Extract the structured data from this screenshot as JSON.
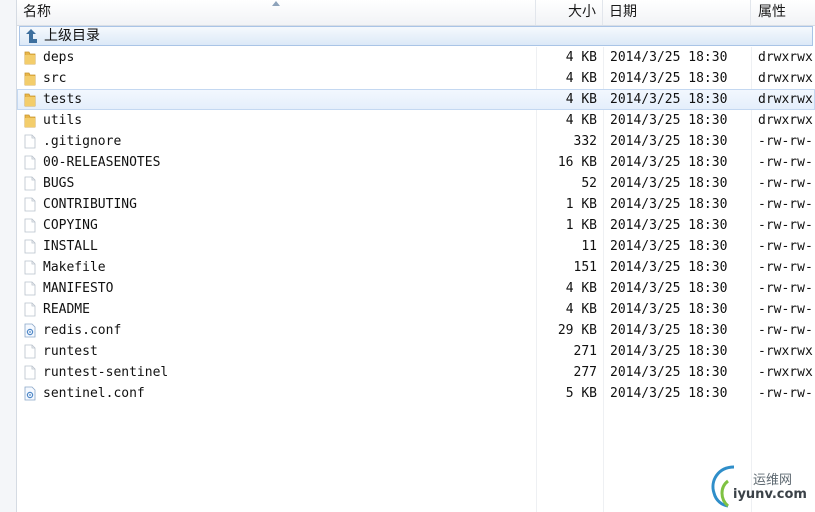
{
  "columns": {
    "name": "名称",
    "size": "大小",
    "date": "日期",
    "attributes": "属性"
  },
  "up_row": {
    "label": "上级目录"
  },
  "files": [
    {
      "name": "deps",
      "size": "4 KB",
      "date": "2014/3/25 18:30",
      "attr": "drwxrwxr",
      "type": "folder"
    },
    {
      "name": "src",
      "size": "4 KB",
      "date": "2014/3/25 18:30",
      "attr": "drwxrwxr",
      "type": "folder"
    },
    {
      "name": "tests",
      "size": "4 KB",
      "date": "2014/3/25 18:30",
      "attr": "drwxrwxr",
      "type": "folder",
      "selected": true
    },
    {
      "name": "utils",
      "size": "4 KB",
      "date": "2014/3/25 18:30",
      "attr": "drwxrwxr",
      "type": "folder"
    },
    {
      "name": ".gitignore",
      "size": "332",
      "date": "2014/3/25 18:30",
      "attr": "-rw-rw-r",
      "type": "file"
    },
    {
      "name": "00-RELEASENOTES",
      "size": "16 KB",
      "date": "2014/3/25 18:30",
      "attr": "-rw-rw-r",
      "type": "file"
    },
    {
      "name": "BUGS",
      "size": "52",
      "date": "2014/3/25 18:30",
      "attr": "-rw-rw-r",
      "type": "file"
    },
    {
      "name": "CONTRIBUTING",
      "size": "1 KB",
      "date": "2014/3/25 18:30",
      "attr": "-rw-rw-r",
      "type": "file"
    },
    {
      "name": "COPYING",
      "size": "1 KB",
      "date": "2014/3/25 18:30",
      "attr": "-rw-rw-r",
      "type": "file"
    },
    {
      "name": "INSTALL",
      "size": "11",
      "date": "2014/3/25 18:30",
      "attr": "-rw-rw-r",
      "type": "file"
    },
    {
      "name": "Makefile",
      "size": "151",
      "date": "2014/3/25 18:30",
      "attr": "-rw-rw-r",
      "type": "file"
    },
    {
      "name": "MANIFESTO",
      "size": "4 KB",
      "date": "2014/3/25 18:30",
      "attr": "-rw-rw-r",
      "type": "file"
    },
    {
      "name": "README",
      "size": "4 KB",
      "date": "2014/3/25 18:30",
      "attr": "-rw-rw-r",
      "type": "file"
    },
    {
      "name": "redis.conf",
      "size": "29 KB",
      "date": "2014/3/25 18:30",
      "attr": "-rw-rw-r",
      "type": "conf"
    },
    {
      "name": "runtest",
      "size": "271",
      "date": "2014/3/25 18:30",
      "attr": "-rwxrwxr",
      "type": "file"
    },
    {
      "name": "runtest-sentinel",
      "size": "277",
      "date": "2014/3/25 18:30",
      "attr": "-rwxrwxr",
      "type": "file"
    },
    {
      "name": "sentinel.conf",
      "size": "5 KB",
      "date": "2014/3/25 18:30",
      "attr": "-rw-rw-r",
      "type": "conf"
    }
  ],
  "icons": {
    "folder": "folder-icon",
    "file": "file-icon",
    "conf": "config-file-icon",
    "up": "up-arrow-icon"
  },
  "watermark": {
    "line1": "运维网",
    "line2": "iyunv.com"
  },
  "colors": {
    "folder": "#e8b64a",
    "selection": "#dfeafa",
    "up_row": "#dce9f7"
  }
}
